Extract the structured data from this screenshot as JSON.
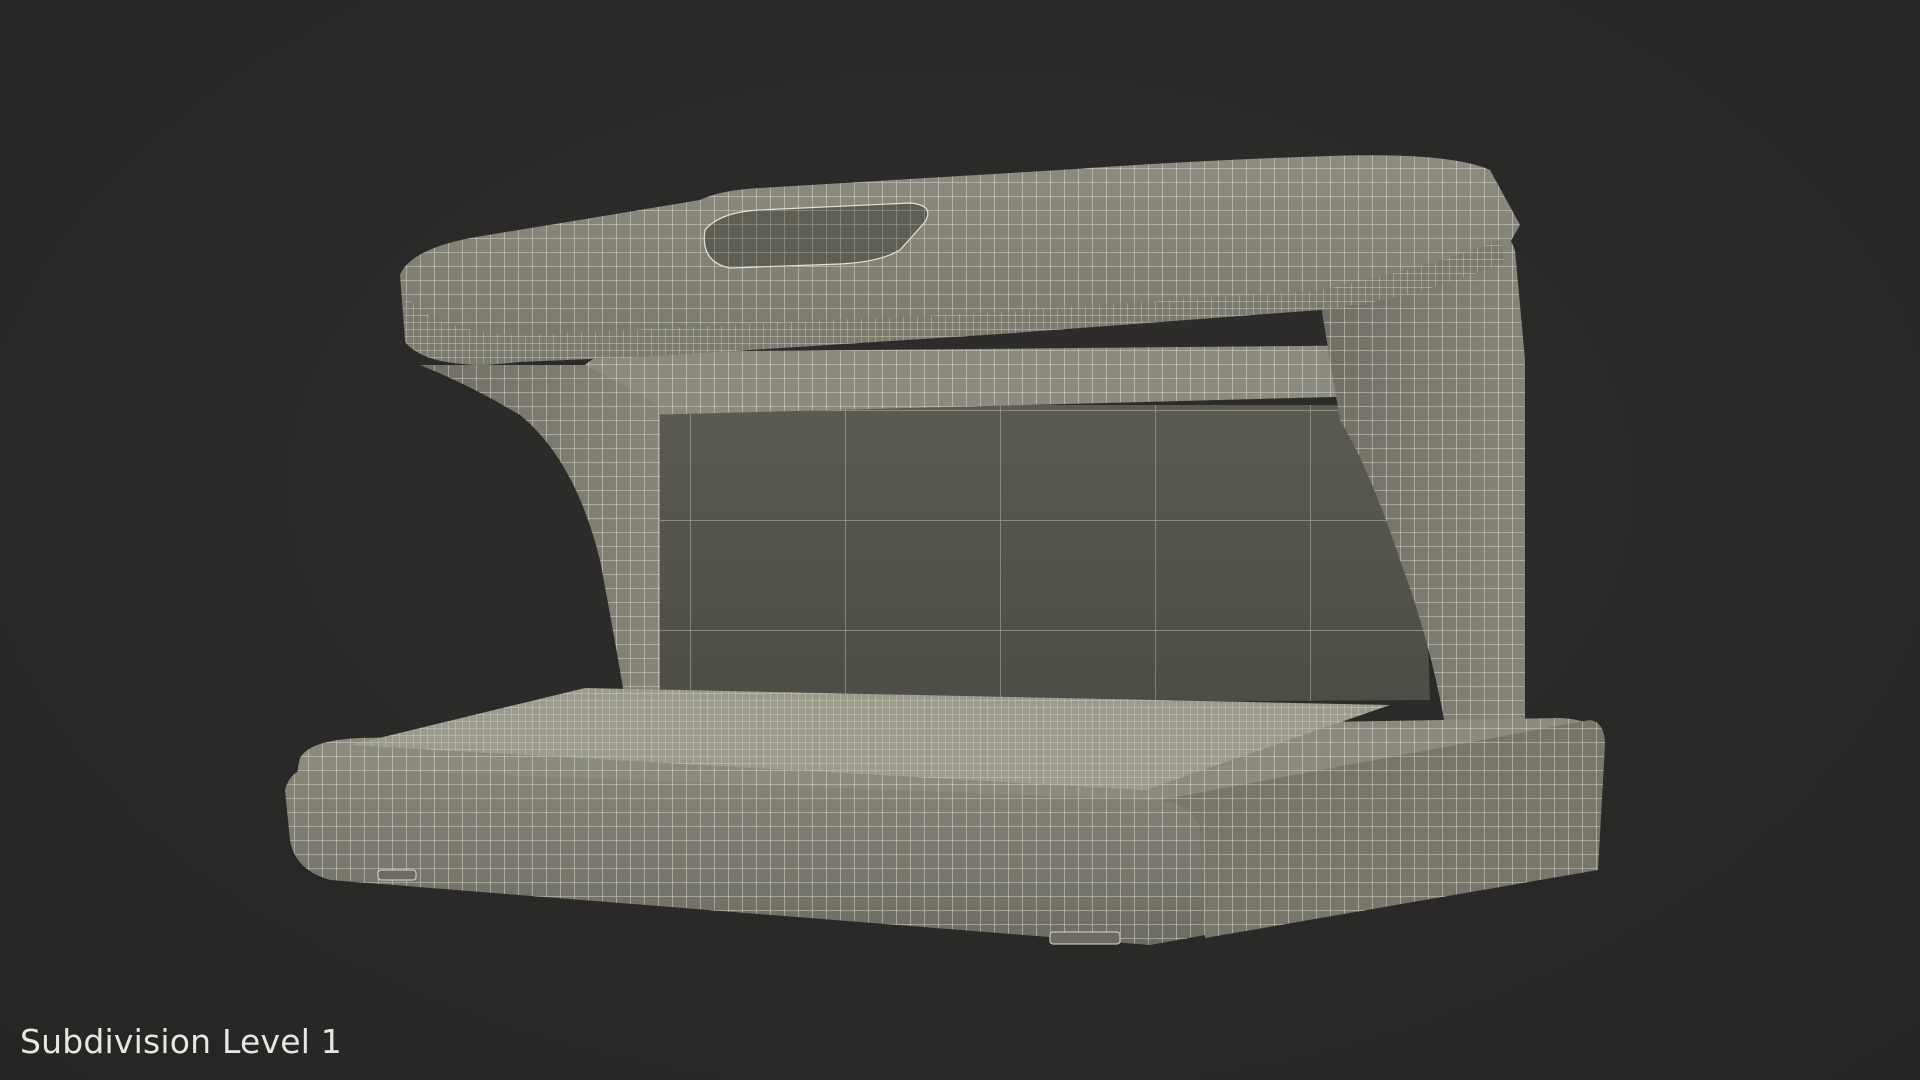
{
  "viewport": {
    "background_color": "#2b2a29",
    "wire_color": "#e8e6d6",
    "surface_color": "#7f7f74"
  },
  "model": {
    "subject": "uv-currency-detector-wireframe"
  },
  "caption": {
    "text": "Subdivision Level 1"
  }
}
